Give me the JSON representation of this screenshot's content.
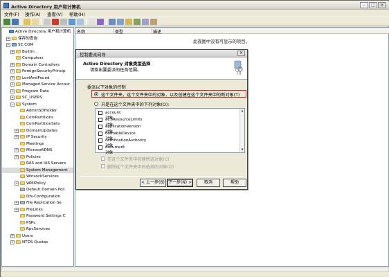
{
  "window": {
    "title": "Active Directory 用户和计算机",
    "buttons": {
      "minimize": "–",
      "maximize": "□",
      "close": "×"
    }
  },
  "menu": [
    "文件(F)",
    "操作(A)",
    "查看(V)",
    "帮助(H)"
  ],
  "tree": {
    "items": [
      {
        "label": "Active Directory 用户和计算机",
        "depth": 0,
        "expander": "",
        "icon": "console"
      },
      {
        "label": "保存的查询",
        "depth": 1,
        "expander": "+",
        "icon": "folder"
      },
      {
        "label": "SC.COM",
        "depth": 1,
        "expander": "−",
        "icon": "domain"
      },
      {
        "label": "Builtin",
        "depth": 2,
        "expander": "+",
        "icon": "folder"
      },
      {
        "label": "Computers",
        "depth": 2,
        "expander": "",
        "icon": "folder"
      },
      {
        "label": "Domain Controllers",
        "depth": 2,
        "expander": "+",
        "icon": "folder"
      },
      {
        "label": "ForeignSecurityPrincip",
        "depth": 2,
        "expander": "+",
        "icon": "folder"
      },
      {
        "label": "LostAndFound",
        "depth": 2,
        "expander": "+",
        "icon": "folder"
      },
      {
        "label": "Managed Service Accour",
        "depth": 2,
        "expander": "+",
        "icon": "folder"
      },
      {
        "label": "Program Data",
        "depth": 2,
        "expander": "+",
        "icon": "folder"
      },
      {
        "label": "SC_USERS",
        "depth": 2,
        "expander": "+",
        "icon": "folder"
      },
      {
        "label": "System",
        "depth": 2,
        "expander": "−",
        "icon": "folder"
      },
      {
        "label": "AdminSDHolder",
        "depth": 3,
        "expander": "",
        "icon": "folder"
      },
      {
        "label": "ComPartitions",
        "depth": 3,
        "expander": "",
        "icon": "folder"
      },
      {
        "label": "ComPartitionSets",
        "depth": 3,
        "expander": "",
        "icon": "folder"
      },
      {
        "label": "DomainUpdates",
        "depth": 3,
        "expander": "+",
        "icon": "folder"
      },
      {
        "label": "IP Security",
        "depth": 3,
        "expander": "+",
        "icon": "folder"
      },
      {
        "label": "Meetings",
        "depth": 3,
        "expander": "",
        "icon": "folder"
      },
      {
        "label": "MicrosoftDNS",
        "depth": 3,
        "expander": "+",
        "icon": "folder"
      },
      {
        "label": "Policies",
        "depth": 3,
        "expander": "+",
        "icon": "folder"
      },
      {
        "label": "RAS and IAS Servers",
        "depth": 3,
        "expander": "",
        "icon": "folder"
      },
      {
        "label": "System Management",
        "depth": 3,
        "expander": "",
        "icon": "folder",
        "selected": true
      },
      {
        "label": "WinsockServices",
        "depth": 3,
        "expander": "",
        "icon": "folder"
      },
      {
        "label": "WMIPolicy",
        "depth": 3,
        "expander": "+",
        "icon": "folder"
      },
      {
        "label": "Default Domain Poli",
        "depth": 3,
        "expander": "",
        "icon": "gear"
      },
      {
        "label": "Dfs-Configuration",
        "depth": 3,
        "expander": "",
        "icon": "folder"
      },
      {
        "label": "File Replication Se",
        "depth": 3,
        "expander": "+",
        "icon": "gear"
      },
      {
        "label": "FileLinks",
        "depth": 3,
        "expander": "+",
        "icon": "folder"
      },
      {
        "label": "Password Settings C",
        "depth": 3,
        "expander": "",
        "icon": "folder"
      },
      {
        "label": "PSPs",
        "depth": 3,
        "expander": "",
        "icon": "folder"
      },
      {
        "label": "RpcServices",
        "depth": 3,
        "expander": "",
        "icon": "folder"
      },
      {
        "label": "Users",
        "depth": 2,
        "expander": "+",
        "icon": "folder"
      },
      {
        "label": "NTDS Quotas",
        "depth": 2,
        "expander": "+",
        "icon": "folder"
      }
    ]
  },
  "list": {
    "columns": [
      "名称",
      "类型",
      "描述"
    ],
    "empty_text": "此视图中没有可显示的项目。"
  },
  "dialog": {
    "title": "控制委派向导",
    "close": "×",
    "heading": "Active Directory 对象类型选择",
    "subheading": "请指出要委派的任务范围。",
    "delegate_label": "委派以下对象的控制",
    "option_folder": "这个文件夹，这个文件夹中的对象，以及创建在这个文件夹中的新对象(T)",
    "option_only": "只是在这个文件夹中的下列对象(O):",
    "objects": [
      "account 对象",
      "aCSResourceLimits 对象",
      "applicationVersion 对象",
      "bootableDevice 对象",
      "certificationAuthority 对象",
      "document 对象"
    ],
    "create_selected": "在这个文件夹中创建所选对象(C)",
    "delete_selected": "删除这个文件夹中的选择的对象(D)",
    "buttons": {
      "back": "< 上一步(B)",
      "next": "下一步(N) >",
      "cancel": "取消",
      "help": "帮助"
    }
  }
}
